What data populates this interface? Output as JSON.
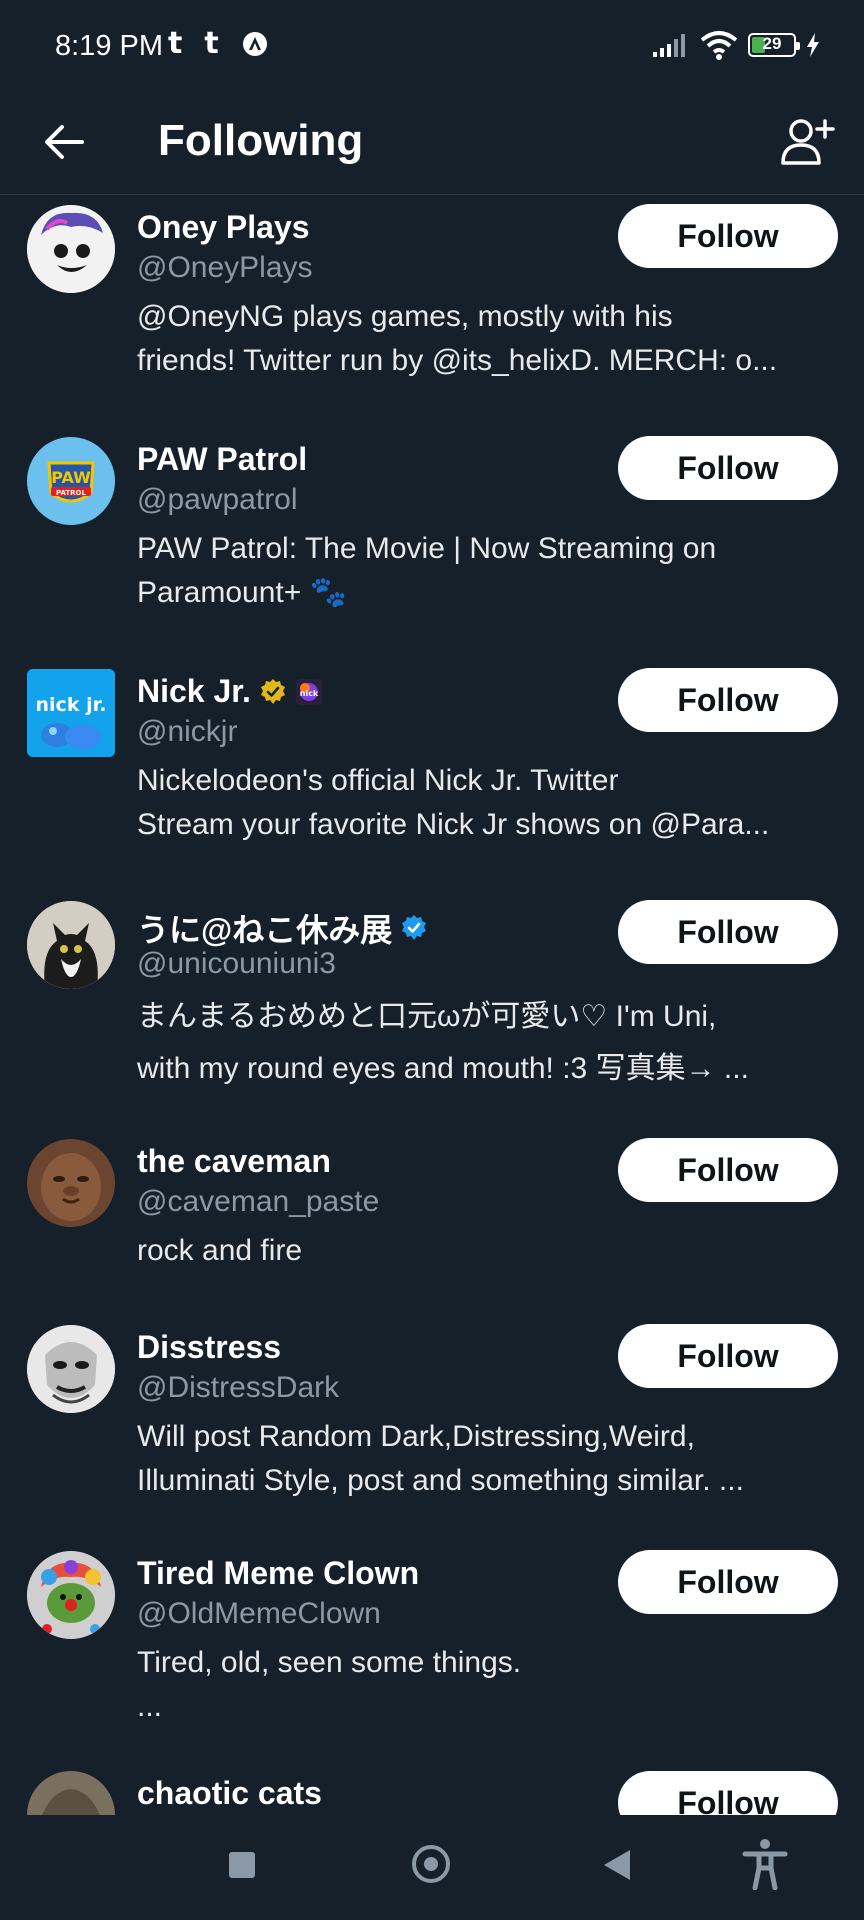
{
  "status_bar": {
    "time": "8:19 PM",
    "left_icons": [
      "tumblr-icon",
      "tumblr-icon",
      "vpn-icon"
    ],
    "battery_level": "29",
    "battery_percent": 29,
    "right_icons": [
      "signal-icon",
      "wifi-icon",
      "battery-icon",
      "charging-icon"
    ]
  },
  "header": {
    "title": "Following",
    "back_icon": "arrow-left-icon",
    "action_icon": "add-user-icon"
  },
  "accounts": [
    {
      "name": "Oney Plays",
      "handle": "@OneyPlays",
      "bio": [
        "@OneyNG plays games, mostly with his",
        "friends! Twitter run by @its_helixD. MERCH: o..."
      ],
      "follow_label": "Follow"
    },
    {
      "name": "PAW Patrol",
      "handle": "@pawpatrol",
      "bio": [
        "PAW Patrol: The Movie | Now Streaming on",
        "Paramount+ 🐾"
      ],
      "follow_label": "Follow"
    },
    {
      "name": "Nick Jr.",
      "handle": "@nickjr",
      "bio": [
        "Nickelodeon's official Nick Jr. Twitter",
        "Stream your favorite Nick Jr shows on @Para..."
      ],
      "follow_label": "Follow",
      "badges": [
        "gold-verified-icon",
        "affiliate-badge-icon"
      ],
      "avatar_text": "nick jr."
    },
    {
      "name": "うに@ねこ休み展",
      "handle": "@unicouniuni3",
      "bio": [
        "まんまるおめめと口元ωが可愛い♡ I'm Uni,",
        "with my round eyes and mouth! :3 写真集→ ..."
      ],
      "follow_label": "Follow",
      "badges": [
        "blue-verified-icon"
      ]
    },
    {
      "name": "the caveman",
      "handle": "@caveman_paste",
      "bio": [
        "rock and fire"
      ],
      "follow_label": "Follow"
    },
    {
      "name": "Disstress",
      "handle": "@DistressDark",
      "bio": [
        "Will post Random Dark,Distressing,Weird,",
        "Illuminati Style, post and something similar. ..."
      ],
      "follow_label": "Follow"
    },
    {
      "name": "Tired Meme Clown",
      "handle": "@OldMemeClown",
      "bio": [
        "Tired, old, seen some things.",
        "..."
      ],
      "follow_label": "Follow"
    },
    {
      "name": "chaotic cats",
      "handle": "",
      "bio": [],
      "follow_label": "Follow"
    }
  ],
  "nav_bar": {
    "icons": [
      "recents-square-icon",
      "home-circle-icon",
      "back-triangle-icon",
      "accessibility-icon"
    ]
  },
  "colors": {
    "background": "#15202b",
    "muted_text": "#8b98a5",
    "verified_blue": "#1d9bf0",
    "verified_gold": "#e2b719",
    "button_bg": "#ffffff"
  }
}
